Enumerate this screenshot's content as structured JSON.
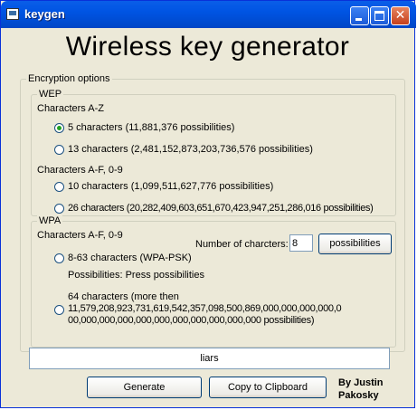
{
  "window": {
    "title": "keygen"
  },
  "heading": "Wireless key generator",
  "encryption": {
    "label": "Encryption options",
    "wep": {
      "label": "WEP",
      "az_label": "Characters A-Z",
      "az_options": [
        {
          "label": "5 characters (11,881,376 possibilities)",
          "checked": true
        },
        {
          "label": "13 characters (2,481,152,873,203,736,576 possibilities)",
          "checked": false
        }
      ],
      "hex_label": "Characters A-F, 0-9",
      "hex_options": [
        {
          "label": "10 characters (1,099,511,627,776 possibilities)",
          "checked": false
        },
        {
          "label": "26 characters (20,282,409,603,651,670,423,947,251,286,016 possibilities)",
          "checked": false
        }
      ]
    },
    "wpa": {
      "label": "WPA",
      "hex_label": "Characters A-F, 0-9",
      "option_psk": "8-63 characters (WPA-PSK)",
      "possibilities_text": "Possibilities:   Press possibilities",
      "num_chars_label": "Number of charcters:",
      "num_chars_value": "8",
      "possibilities_button": "possibilities",
      "option_64_line1": "64 characters (more then",
      "option_64_line2": "11,579,208,923,731,619,542,357,098,500,869,000,000,000,000,0",
      "option_64_line3": "00,000,000,000,000,000,000,000,000,000,000 possibilities)"
    }
  },
  "output": {
    "value": "liars"
  },
  "buttons": {
    "generate": "Generate",
    "copy": "Copy to Clipboard"
  },
  "credit": {
    "line1": "By Justin",
    "line2": "Pakosky"
  }
}
